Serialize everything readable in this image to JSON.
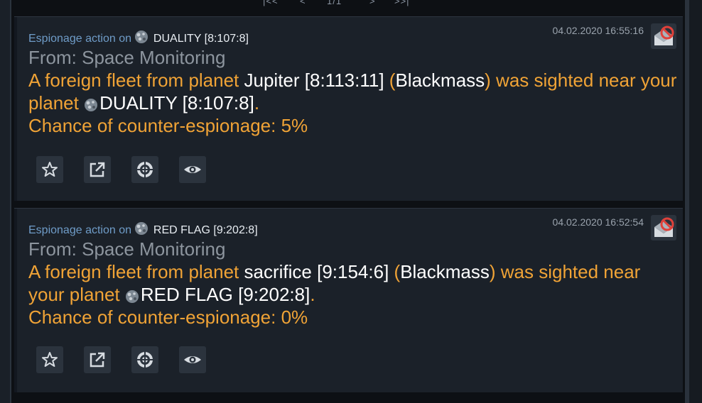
{
  "colors": {
    "accent_orange": "#f0a336",
    "title_blue": "#6f9cc8",
    "muted_gray": "#8d959e",
    "white": "#ffffff",
    "panel": "#1b2129",
    "button": "#2b333d",
    "delete_red": "#e0413a"
  },
  "pager": {
    "first": "|<<",
    "prev": "<",
    "page": "1/1",
    "next": ">",
    "last": ">>|"
  },
  "messages": [
    {
      "title_prefix": "Espionage action on",
      "title_planet": "DUALITY [8:107:8]",
      "date": "04.02.2020 16:55:16",
      "from": "From: Space Monitoring",
      "body_1": "A foreign fleet from planet ",
      "origin_planet": "Jupiter [8:113:11]",
      "body_2": " (",
      "player": "Blackmass",
      "body_3": ") was sighted near your planet ",
      "target_planet": "DUALITY [8:107:8]",
      "body_4": ".",
      "chance": "Chance of counter-espionage: 5%"
    },
    {
      "title_prefix": "Espionage action on",
      "title_planet": "RED FLAG [9:202:8]",
      "date": "04.02.2020 16:52:54",
      "from": "From: Space Monitoring",
      "body_1": "A foreign fleet from planet ",
      "origin_planet": "sacrifice [9:154:6]",
      "body_2": " (",
      "player": "Blackmass",
      "body_3": ") was sighted near your planet ",
      "target_planet": "RED FLAG [9:202:8]",
      "body_4": ".",
      "chance": "Chance of counter-espionage: 0%"
    }
  ],
  "icons": {
    "planet": "planet-icon",
    "delete": "delete-message-icon",
    "favorite": "star-icon",
    "share": "external-link-icon",
    "attack": "target-icon",
    "spy": "eye-icon"
  }
}
